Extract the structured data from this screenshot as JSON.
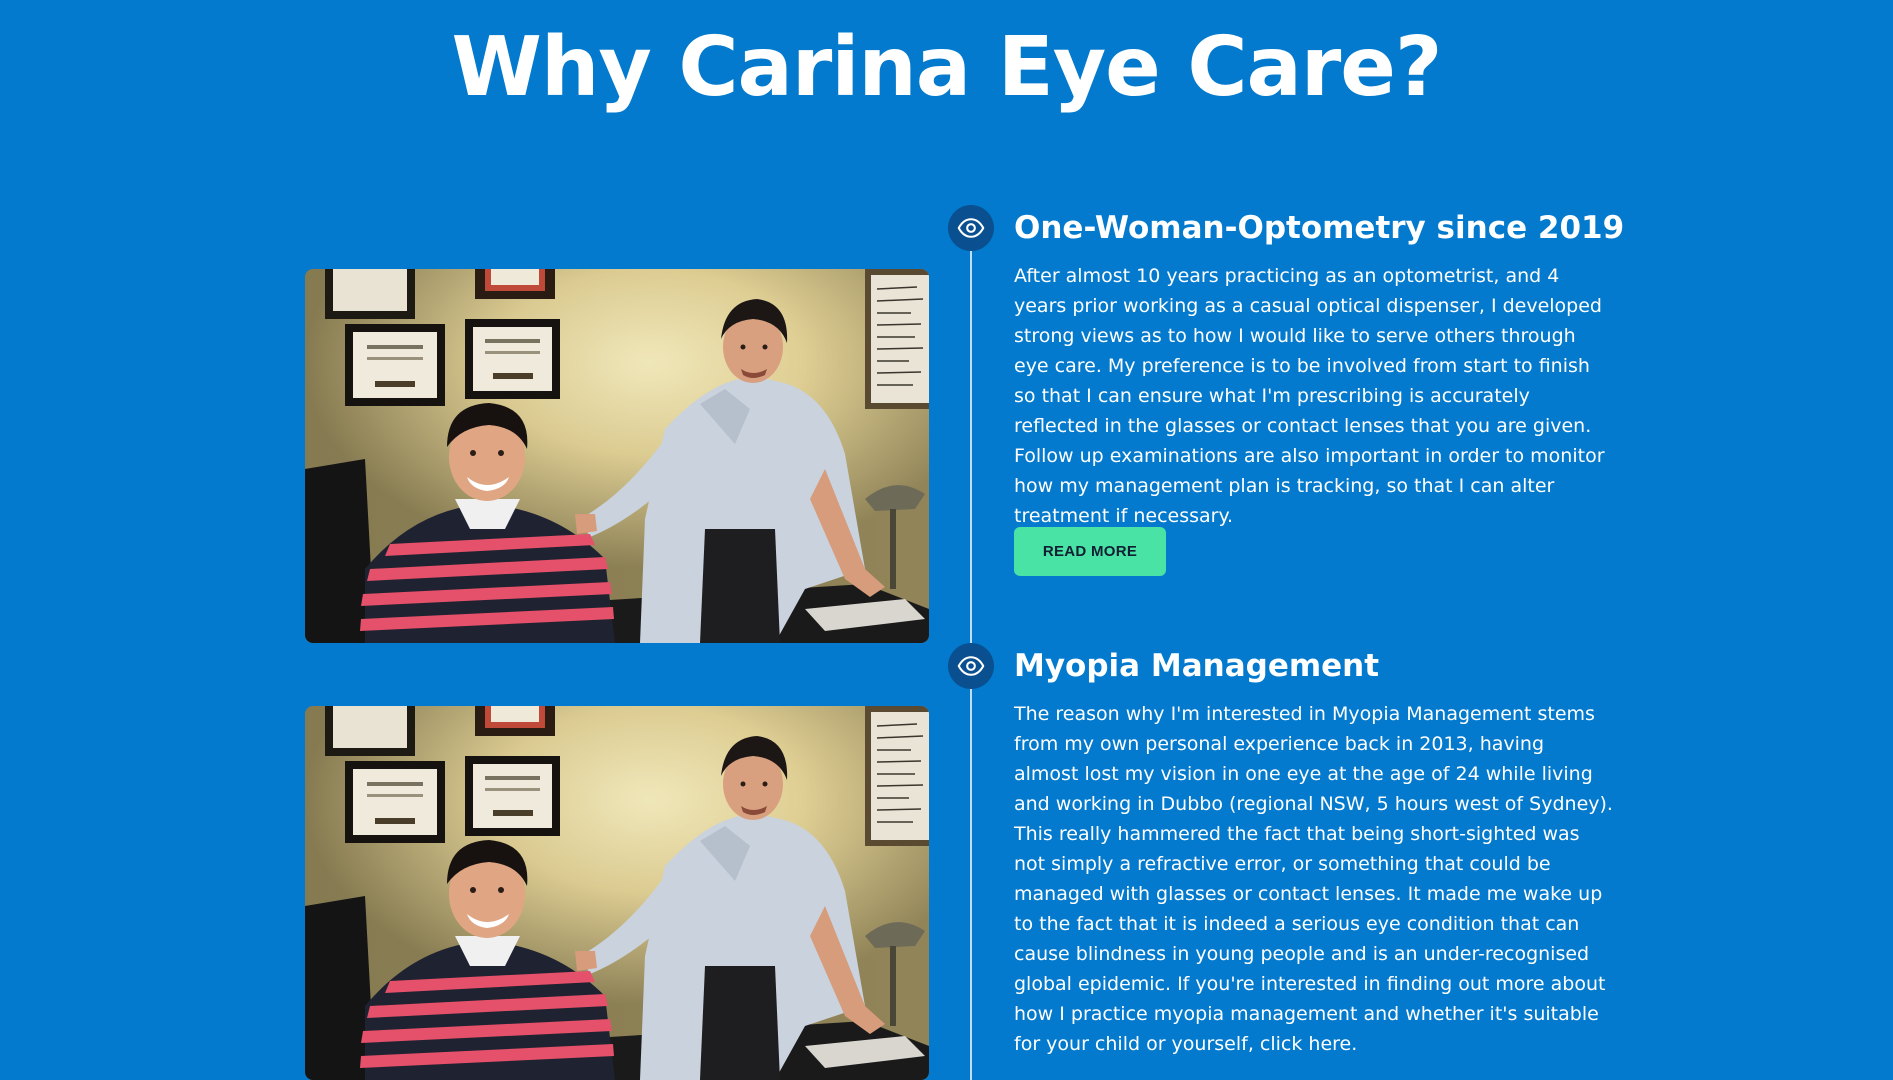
{
  "page": {
    "title": "Why Carina Eye Care?"
  },
  "colors": {
    "background": "#037acd",
    "marker": "#0a4f8f",
    "button": "#48e3a5",
    "text": "#ffffff"
  },
  "timeline": {
    "items": [
      {
        "icon": "eye-icon",
        "title": "One-Woman-Optometry since 2019",
        "text": "After almost 10 years practicing as an optometrist, and 4 years prior working as a casual optical dispenser, I developed strong views as to how I would like to serve others through eye care. My preference is to be involved from start to finish so that I can ensure what I'm prescribing is accurately reflected in the glasses or contact lenses that you are given. Follow up examinations are also important in order to monitor how my management plan is tracking, so that I can alter treatment if necessary.",
        "button_label": "READ MORE"
      },
      {
        "icon": "eye-icon",
        "title": "Myopia Management",
        "text": "The reason why I'm interested in Myopia Management stems from my own personal experience back in 2013, having almost lost my vision in one eye at the age of 24 while living and working in Dubbo (regional NSW, 5 hours west of Sydney). This really hammered the fact that being short-sighted was not simply a refractive error, or something that could be managed with glasses or contact lenses. It made me wake up to the fact that it is indeed a serious eye condition that can cause blindness in young people and is an under-recognised global epidemic. If you're interested in finding out more about how I practice myopia management and whether it's suitable for your child or yourself, click here."
      }
    ]
  }
}
